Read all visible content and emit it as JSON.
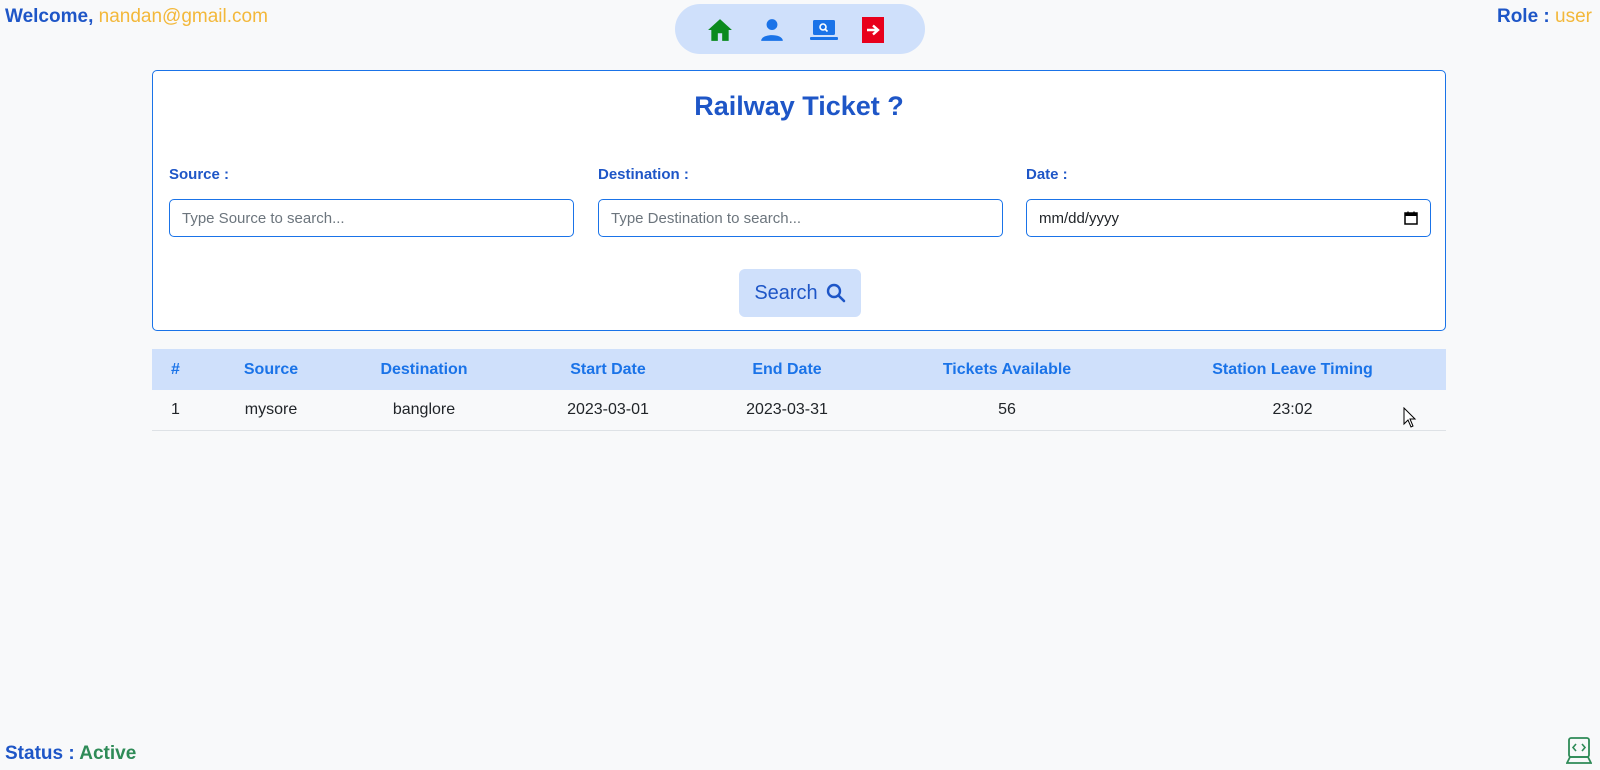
{
  "header": {
    "welcome_label": "Welcome,",
    "email": "nandan@gmail.com",
    "role_label": "Role :",
    "role_value": "user"
  },
  "nav": {
    "items": [
      {
        "icon": "home-icon",
        "color": "#0b8a1e"
      },
      {
        "icon": "user-icon",
        "color": "#1a73e8"
      },
      {
        "icon": "laptop-search-icon",
        "color": "#1a73e8"
      },
      {
        "icon": "logout-icon",
        "color": "#e8001c"
      }
    ]
  },
  "search_form": {
    "title": "Railway Ticket ?",
    "source_label": "Source :",
    "source_placeholder": "Type Source to search...",
    "destination_label": "Destination :",
    "destination_placeholder": "Type Destination to search...",
    "date_label": "Date :",
    "date_placeholder": "mm/dd/yyyy",
    "search_button_label": "Search"
  },
  "table": {
    "headers": [
      "#",
      "Source",
      "Destination",
      "Start Date",
      "End Date",
      "Tickets Available",
      "Station Leave Timing"
    ],
    "rows": [
      [
        "1",
        "mysore",
        "banglore",
        "2023-03-01",
        "2023-03-31",
        "56",
        "23:02"
      ]
    ]
  },
  "footer": {
    "status_label": "Status :",
    "status_value": "Active"
  },
  "colors": {
    "primary": "#1e56c7",
    "accent": "#f3b83a",
    "active": "#2e8b57",
    "pill_bg": "#cfe0fb"
  }
}
